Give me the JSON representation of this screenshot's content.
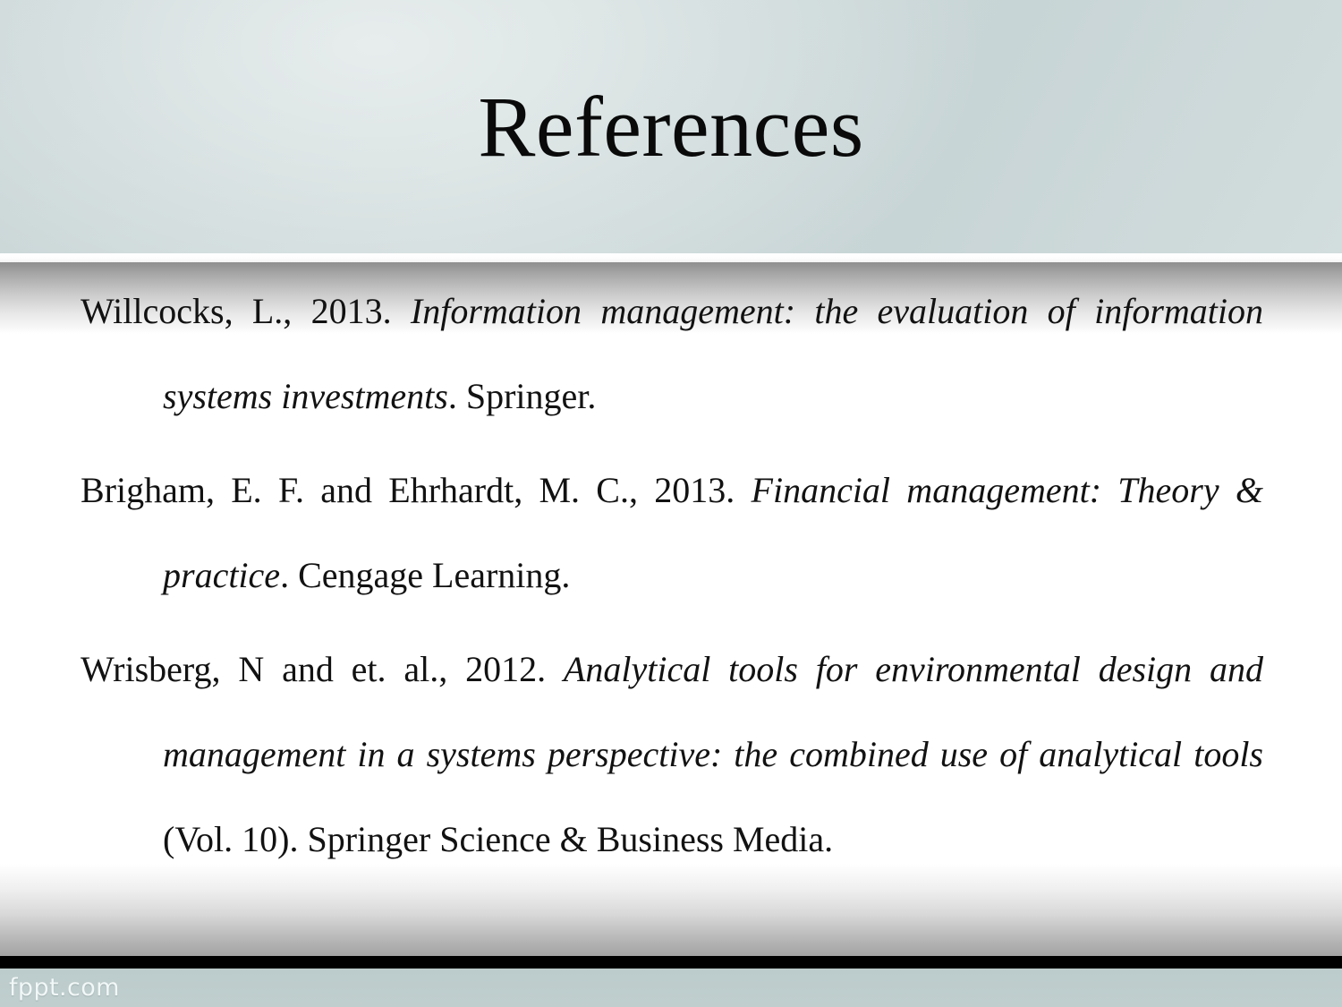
{
  "slide": {
    "title": "References",
    "footer_brand": "fppt.com",
    "colors": {
      "header_band": "#cdd9d9",
      "footer_band": "#bccbcb",
      "footer_rule": "#000000",
      "text": "#121212",
      "brand_text": "#f2f7f7"
    }
  },
  "references": [
    {
      "id": "willcocks-2013",
      "segments": [
        {
          "text": "Willcocks, L., 2013. ",
          "style": "roman"
        },
        {
          "text": "Information management: the evaluation of information systems investments",
          "style": "italic"
        },
        {
          "text": ". Springer.",
          "style": "roman"
        }
      ],
      "plain": "Willcocks, L., 2013. Information management: the evaluation of information systems investments. Springer."
    },
    {
      "id": "brigham-ehrhardt-2013",
      "segments": [
        {
          "text": "Brigham, E. F. and Ehrhardt, M. C., 2013. ",
          "style": "roman"
        },
        {
          "text": "Financial management: Theory & practice",
          "style": "italic"
        },
        {
          "text": ". Cengage Learning.",
          "style": "roman"
        }
      ],
      "plain": "Brigham, E. F. and Ehrhardt, M. C., 2013. Financial management: Theory & practice. Cengage Learning."
    },
    {
      "id": "wrisberg-2012",
      "segments": [
        {
          "text": "Wrisberg, N and et. al., 2012. ",
          "style": "roman"
        },
        {
          "text": "Analytical tools for environmental design and management in a systems perspective: the combined use of analytical tools",
          "style": "italic"
        },
        {
          "text": " (Vol. 10). Springer Science & Business Media.",
          "style": "roman"
        }
      ],
      "plain": "Wrisberg, N and et. al., 2012. Analytical tools for environmental design and management in a systems perspective: the combined use of analytical tools (Vol. 10). Springer Science & Business Media."
    }
  ]
}
